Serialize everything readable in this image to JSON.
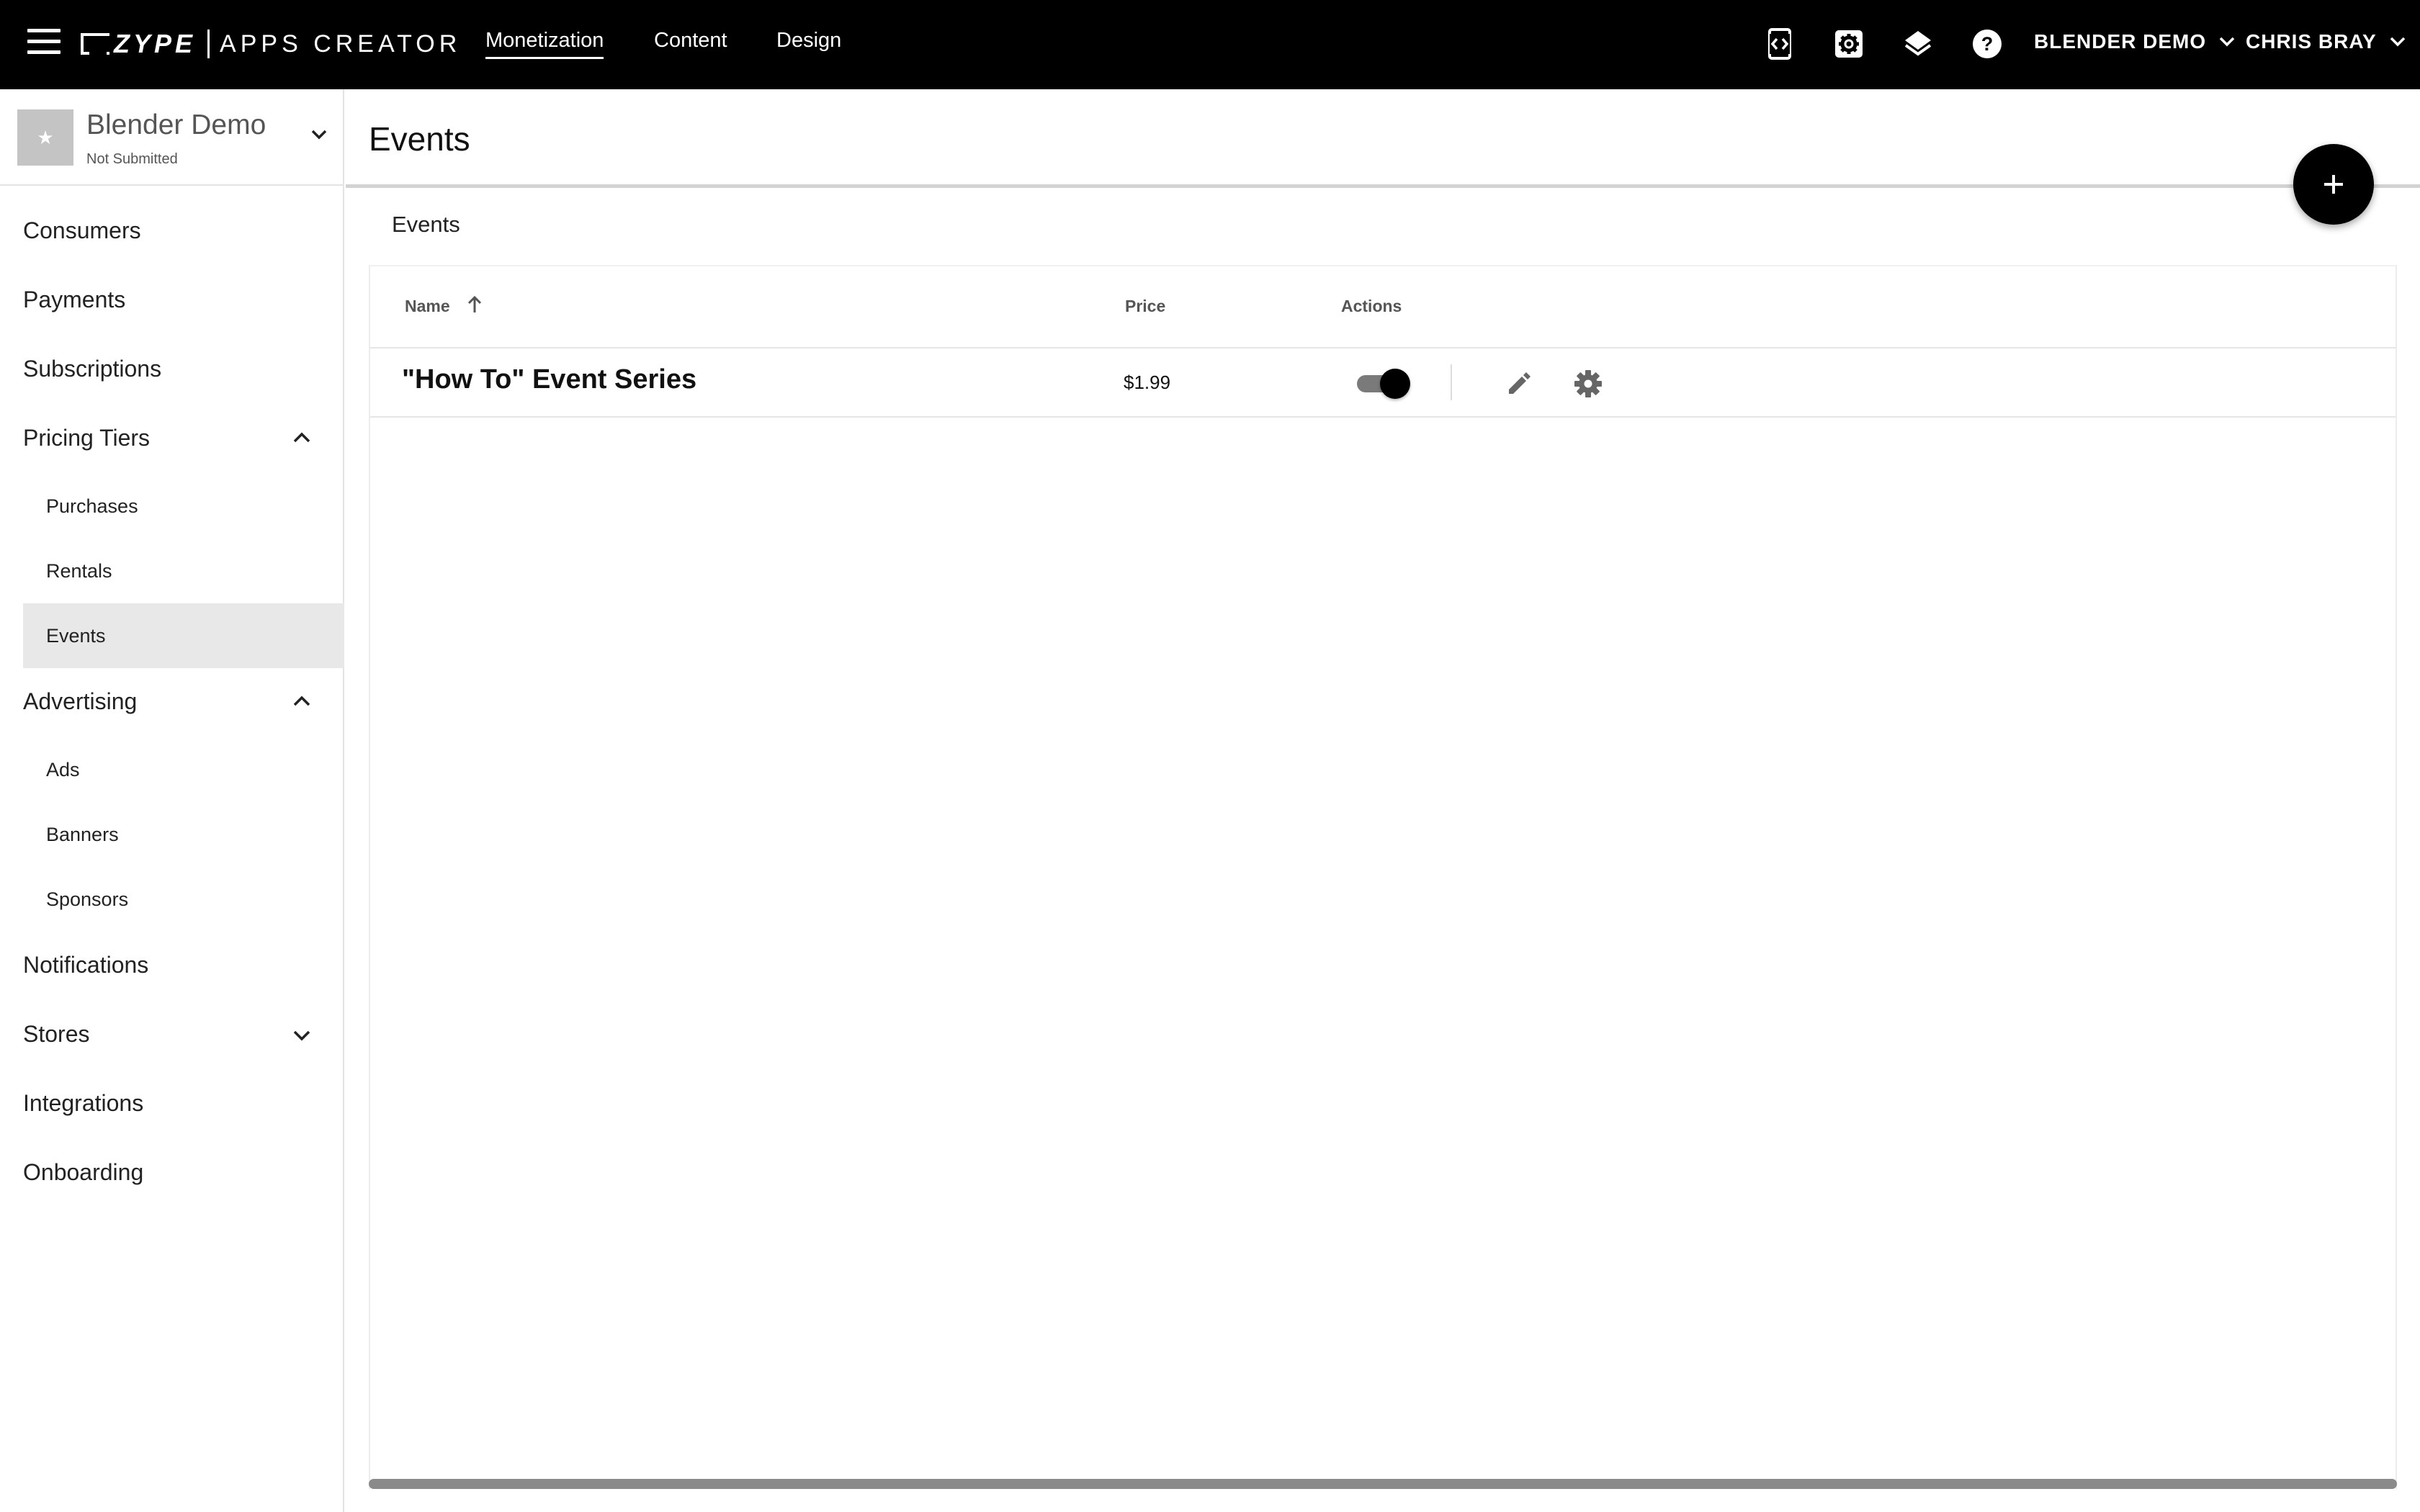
{
  "topbar": {
    "logo_brand": "ZYPE",
    "logo_product": "APPS CREATOR",
    "tabs": [
      {
        "label": "Monetization",
        "active": true
      },
      {
        "label": "Content",
        "active": false
      },
      {
        "label": "Design",
        "active": false
      }
    ],
    "icons": [
      "app-preview-icon",
      "settings-box-icon",
      "layers-icon",
      "help-icon"
    ],
    "app_switcher": "BLENDER DEMO",
    "user_menu": "CHRIS BRAY"
  },
  "sidebar": {
    "app_name": "Blender Demo",
    "app_status": "Not Submitted",
    "thumb_glyph": "★",
    "items": {
      "consumers": "Consumers",
      "payments": "Payments",
      "subscriptions": "Subscriptions",
      "pricing_tiers": "Pricing Tiers",
      "purchases": "Purchases",
      "rentals": "Rentals",
      "events": "Events",
      "advertising": "Advertising",
      "ads": "Ads",
      "banners": "Banners",
      "sponsors": "Sponsors",
      "notifications": "Notifications",
      "stores": "Stores",
      "integrations": "Integrations",
      "onboarding": "Onboarding"
    },
    "selected": "Events"
  },
  "main": {
    "title": "Events",
    "section_label": "Events",
    "table": {
      "columns": {
        "name": "Name",
        "price": "Price",
        "actions": "Actions"
      },
      "sort": {
        "column": "Name",
        "direction": "ascending"
      },
      "rows": [
        {
          "name": "\"How To\" Event Series",
          "price": "$1.99",
          "enabled": true
        }
      ]
    }
  },
  "colors": {
    "topbar_bg": "#000000",
    "selected_bg": "#e8e8e8",
    "fab_bg": "#000000"
  }
}
